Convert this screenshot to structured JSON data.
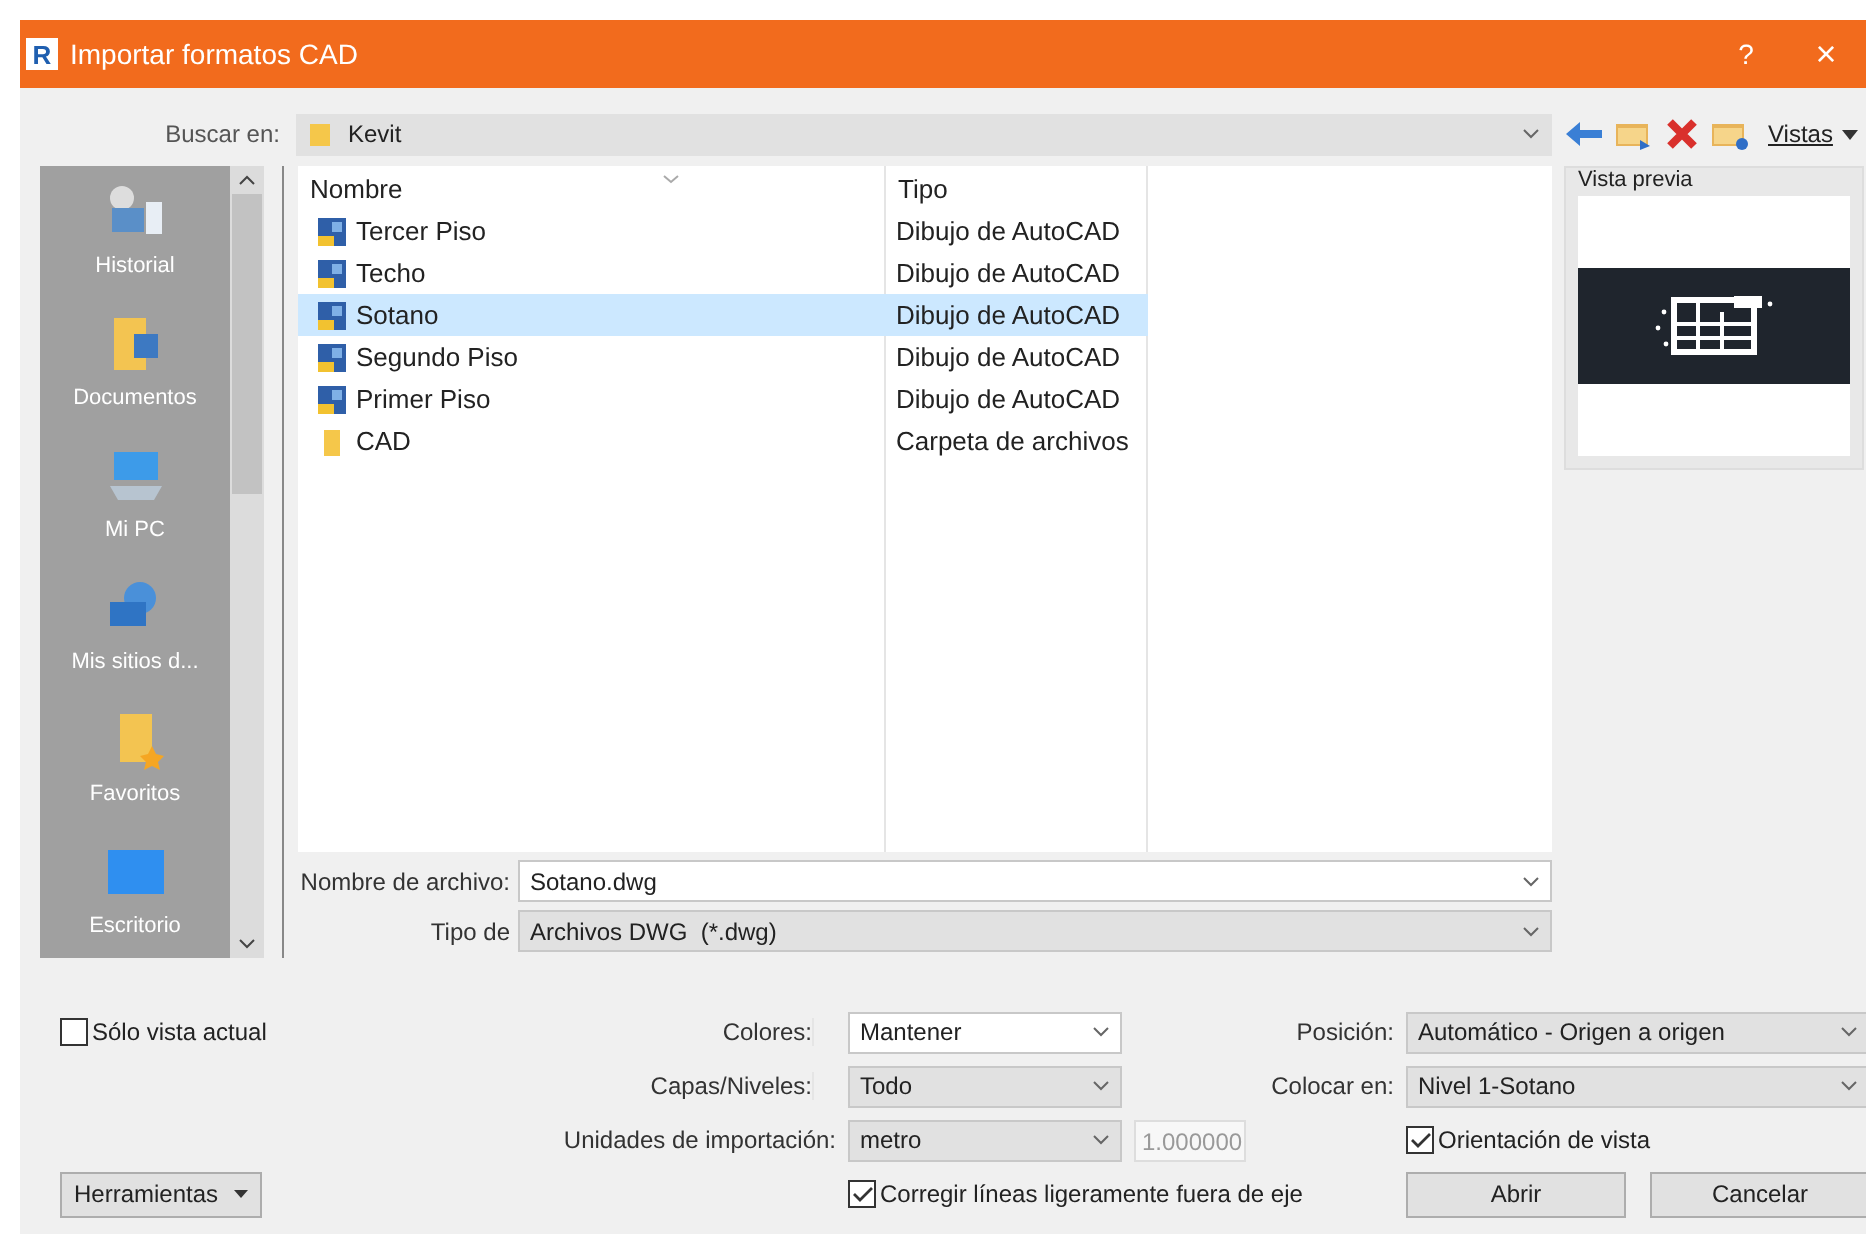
{
  "window": {
    "app_icon": "R",
    "title": "Importar formatos CAD",
    "help": "?",
    "close": "×"
  },
  "look_in": {
    "label": "Buscar en:",
    "value": "Kevit"
  },
  "toolbar": {
    "views": "Vistas"
  },
  "places": [
    {
      "label": "Historial",
      "kind": "history"
    },
    {
      "label": "Documentos",
      "kind": "documents"
    },
    {
      "label": "Mi PC",
      "kind": "pc"
    },
    {
      "label": "Mis sitios d...",
      "kind": "network"
    },
    {
      "label": "Favoritos",
      "kind": "favorites"
    },
    {
      "label": "Escritorio",
      "kind": "desktop"
    }
  ],
  "file_list": {
    "columns": [
      "Nombre",
      "Tipo"
    ],
    "rows": [
      {
        "name": "Tercer Piso",
        "type": "Dibujo de AutoCAD",
        "kind": "drawing",
        "selected": false
      },
      {
        "name": "Techo",
        "type": "Dibujo de AutoCAD",
        "kind": "drawing",
        "selected": false
      },
      {
        "name": "Sotano",
        "type": "Dibujo de AutoCAD",
        "kind": "drawing",
        "selected": true
      },
      {
        "name": "Segundo Piso",
        "type": "Dibujo de AutoCAD",
        "kind": "drawing",
        "selected": false
      },
      {
        "name": "Primer Piso",
        "type": "Dibujo de AutoCAD",
        "kind": "drawing",
        "selected": false
      },
      {
        "name": "CAD",
        "type": "Carpeta de archivos",
        "kind": "folder",
        "selected": false
      }
    ]
  },
  "preview": {
    "title": "Vista previa"
  },
  "file_name": {
    "label": "Nombre de archivo:",
    "value": "Sotano.dwg"
  },
  "file_type": {
    "label": "Tipo de",
    "value": "Archivos DWG  (*.dwg)"
  },
  "current_view_only": {
    "label": "Sólo vista actual",
    "checked": false
  },
  "colors": {
    "label": "Colores:",
    "value": "Mantener"
  },
  "layers": {
    "label": "Capas/Niveles:",
    "value": "Todo"
  },
  "units": {
    "label": "Unidades de importación:",
    "value": "metro",
    "factor": "1.000000"
  },
  "fix_lines": {
    "label": "Corregir líneas ligeramente fuera de eje",
    "checked": true
  },
  "position": {
    "label": "Posición:",
    "value": "Automático - Origen a origen"
  },
  "place_at": {
    "label": "Colocar en:",
    "value": "Nivel 1-Sotano"
  },
  "orient_to_view": {
    "label": "Orientación de vista",
    "checked": true
  },
  "buttons": {
    "tools": "Herramientas",
    "open": "Abrir",
    "cancel": "Cancelar"
  }
}
